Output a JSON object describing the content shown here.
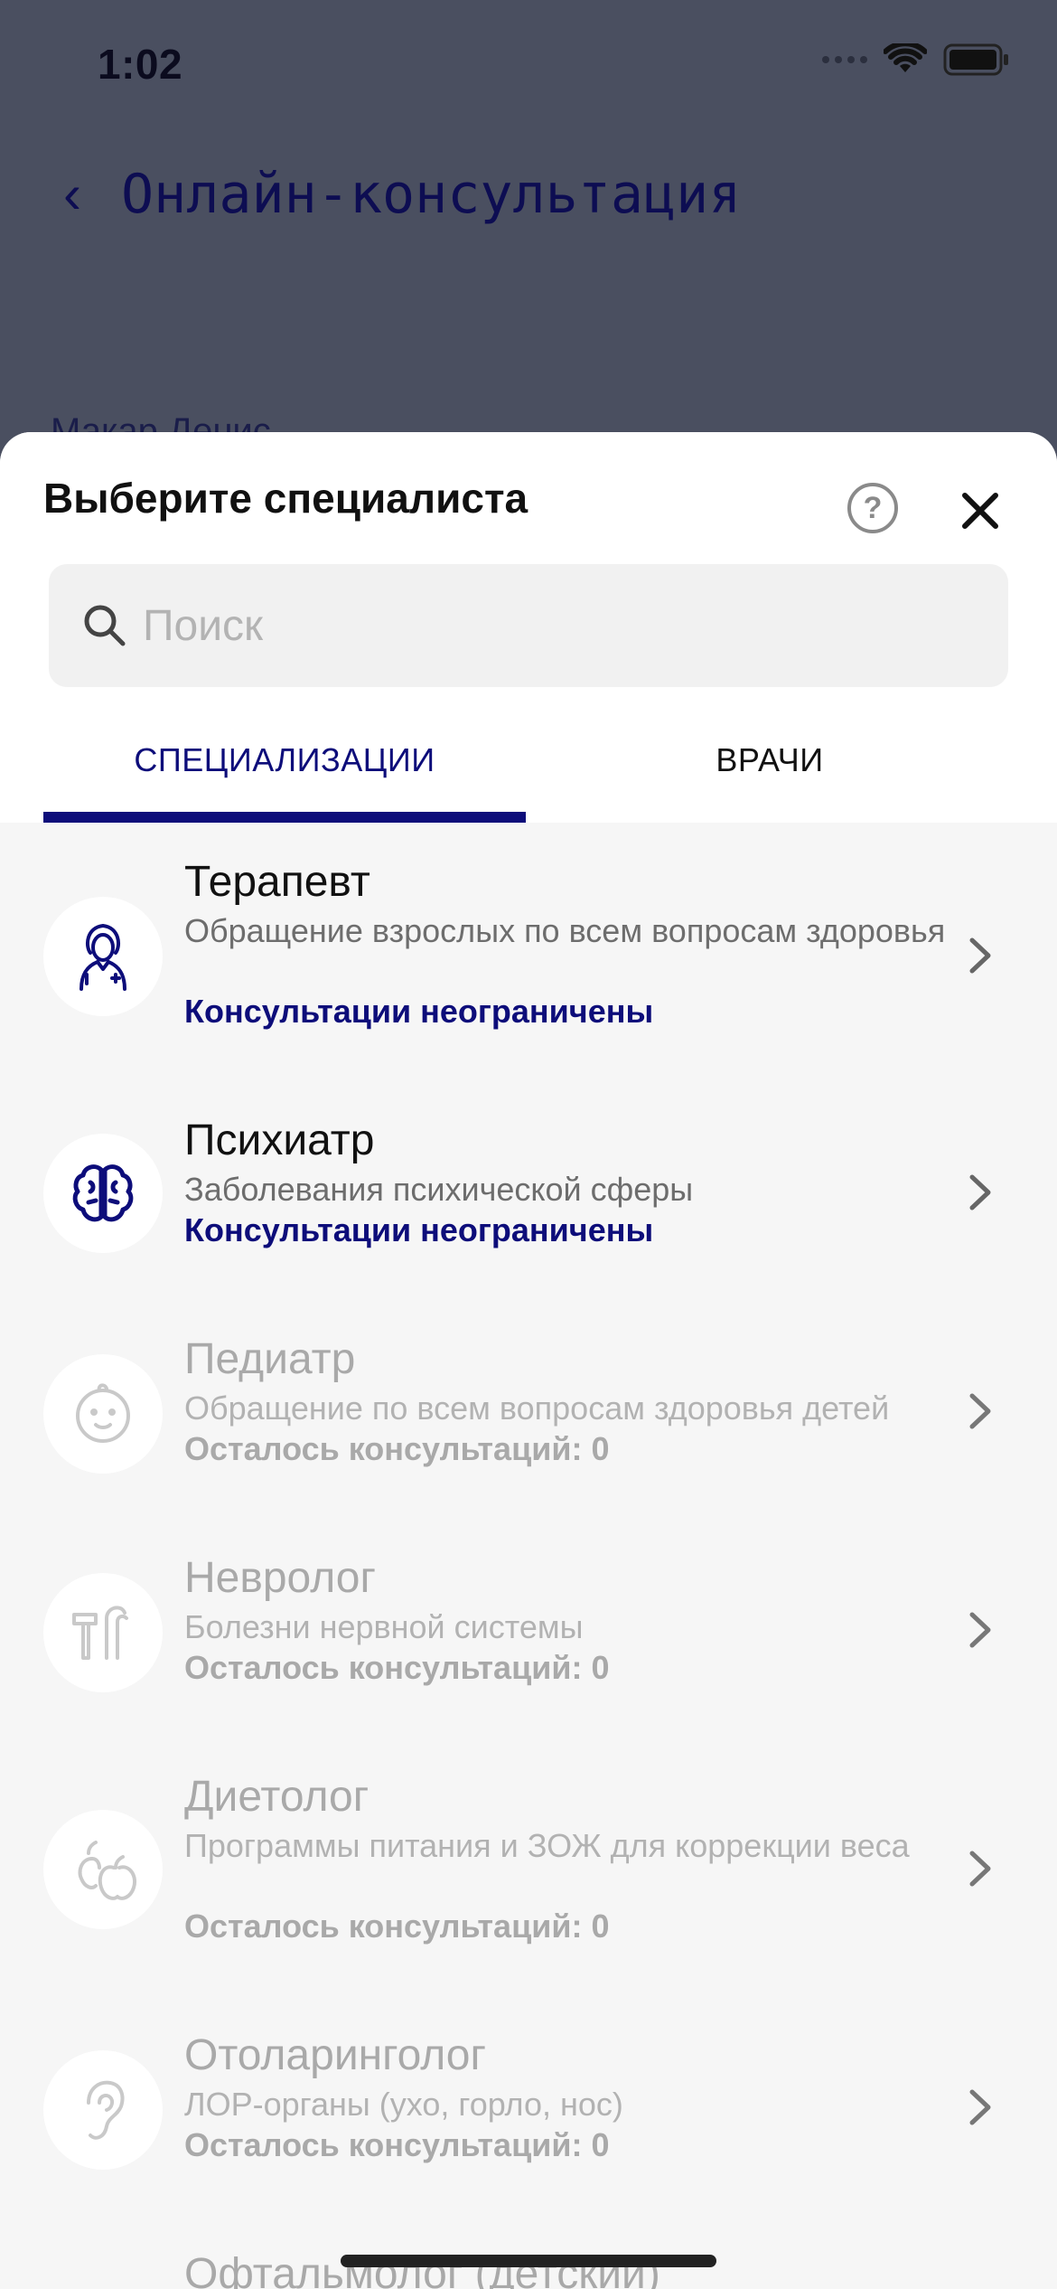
{
  "status_bar": {
    "time": "1:02"
  },
  "background": {
    "back_icon": "chevron-left",
    "title": "Онлайн-консультация",
    "peek_text": "Макар Денис"
  },
  "sheet": {
    "title": "Выберите специалиста",
    "help_icon": "question-circle",
    "close_icon": "close-x",
    "search": {
      "placeholder": "Поиск",
      "value": "",
      "icon": "search"
    },
    "tabs": [
      {
        "label": "СПЕЦИАЛИЗАЦИИ",
        "active": true
      },
      {
        "label": "ВРАЧИ",
        "active": false
      }
    ],
    "items": [
      {
        "name": "Терапевт",
        "description": "Обращение взрослых по всем вопросам здоровья",
        "status": "Консультации неограничены",
        "icon": "doctor-icon",
        "enabled": true
      },
      {
        "name": "Психиатр",
        "description": "Заболевания психической сферы",
        "status": "Консультации неограничены",
        "icon": "brain-icon",
        "enabled": true
      },
      {
        "name": "Педиатр",
        "description": "Обращение по всем вопросам здоровья детей",
        "status": "Осталось консультаций: 0",
        "icon": "baby-face-icon",
        "enabled": false
      },
      {
        "name": "Невролог",
        "description": "Болезни нервной системы",
        "status": "Осталось консультаций: 0",
        "icon": "reflex-hammer-icon",
        "enabled": false
      },
      {
        "name": "Диетолог",
        "description": "Программы питания и ЗОЖ для коррекции веса",
        "status": "Осталось консультаций: 0",
        "icon": "apple-pear-icon",
        "enabled": false
      },
      {
        "name": "Отоларинголог",
        "description": "ЛОР-органы (ухо, горло, нос)",
        "status": "Осталось консультаций: 0",
        "icon": "ear-icon",
        "enabled": false
      },
      {
        "name": "Офтальмолог (детский)",
        "enabled": false
      }
    ]
  },
  "colors": {
    "accent": "#0d0d7a",
    "overlay": "#4a4f60",
    "disabled_text": "#a9a9a9"
  }
}
